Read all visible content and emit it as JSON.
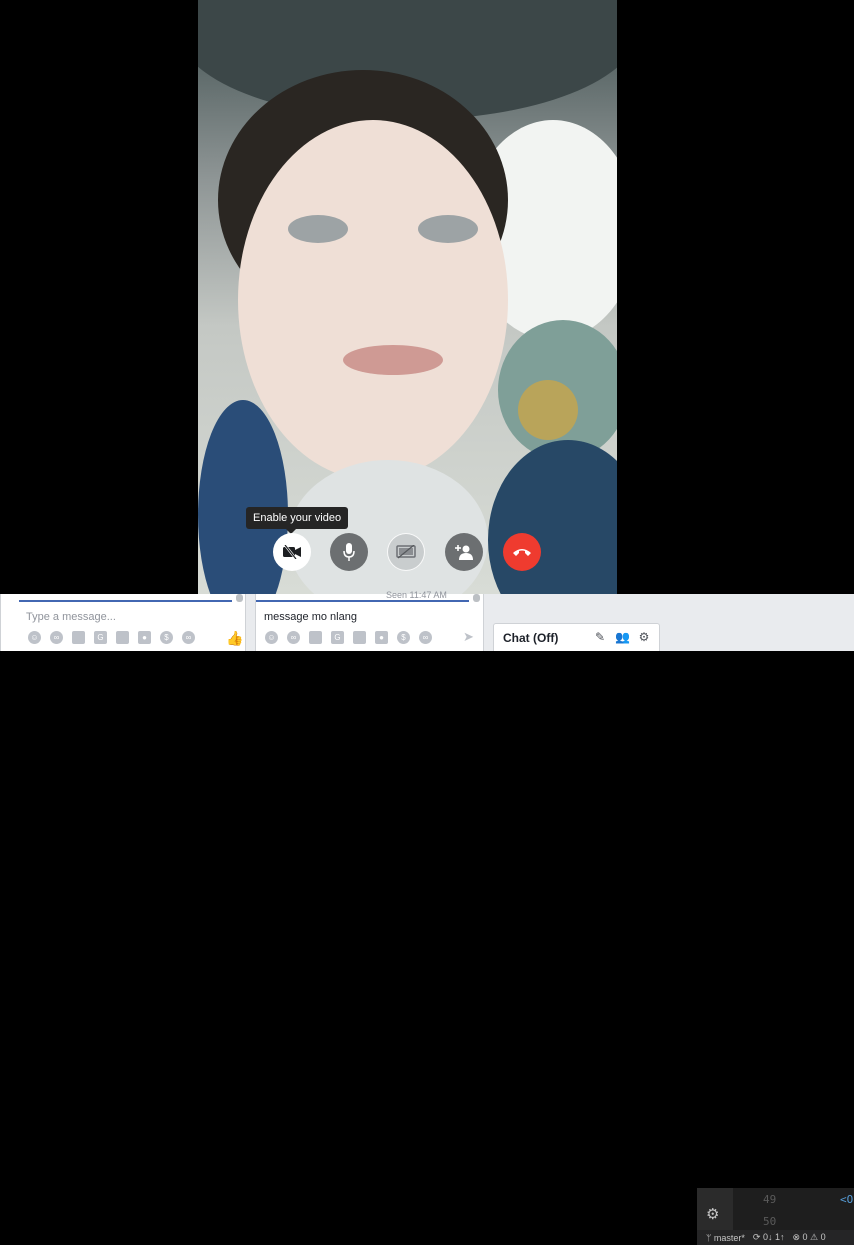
{
  "call": {
    "tooltip": "Enable your video",
    "controls": [
      {
        "name": "enable-video-button",
        "icon": "video-off-icon",
        "state": "off"
      },
      {
        "name": "microphone-button",
        "icon": "microphone-icon"
      },
      {
        "name": "share-screen-button",
        "icon": "screen-share-off-icon"
      },
      {
        "name": "add-person-button",
        "icon": "add-person-icon"
      },
      {
        "name": "end-call-button",
        "icon": "phone-hangup-icon",
        "color": "#ef3b2f"
      }
    ]
  },
  "chats": [
    {
      "placeholder": "Type a message..."
    },
    {
      "value": "message mo nlang",
      "timestamp_partial": "Seen 11:47 AM"
    }
  ],
  "chat_off": {
    "label": "Chat (Off)"
  },
  "editor": {
    "line_numbers": [
      "49",
      "50"
    ],
    "code_fragment": "<O",
    "status": {
      "branch": "master*",
      "sync": "0↓ 1↑",
      "errors": "0",
      "warnings": "0"
    }
  },
  "colors": {
    "accent": "#4267b2",
    "end_call": "#ef3b2f"
  }
}
